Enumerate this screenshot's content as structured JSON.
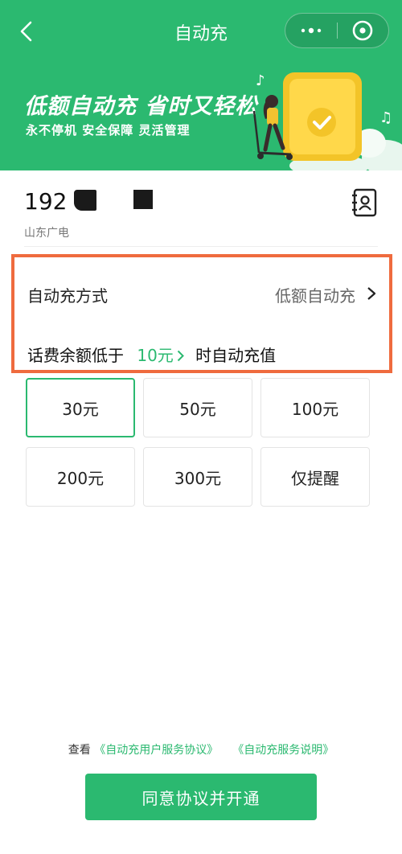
{
  "nav": {
    "title": "自动充"
  },
  "banner": {
    "slogan": "低额自动充 省时又轻松",
    "sub": "永不停机  安全保障  灵活管理"
  },
  "account": {
    "phone_prefix": "192",
    "carrier": "山东广电"
  },
  "method": {
    "label": "自动充方式",
    "value": "低额自动充",
    "threshold_prefix": "话费余额低于",
    "threshold_value": "10元",
    "threshold_suffix": "时自动充值"
  },
  "amounts": [
    {
      "label": "30元",
      "selected": true
    },
    {
      "label": "50元",
      "selected": false
    },
    {
      "label": "100元",
      "selected": false
    },
    {
      "label": "200元",
      "selected": false
    },
    {
      "label": "300元",
      "selected": false
    },
    {
      "label": "仅提醒",
      "selected": false
    }
  ],
  "footer": {
    "view_prefix": "查看",
    "agreement_1": "《自动充用户服务协议》",
    "agreement_2": "《自动充服务说明》",
    "submit_label": "同意协议并开通"
  },
  "colors": {
    "brand_green": "#2bb970",
    "highlight_orange": "#ef6b3e"
  }
}
